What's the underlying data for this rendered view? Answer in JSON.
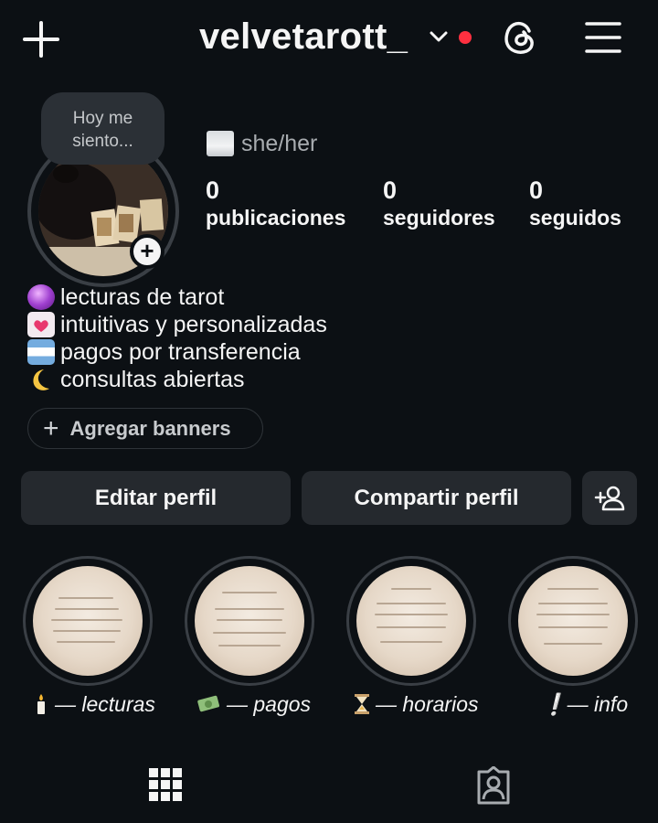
{
  "header": {
    "username": "velvetarott_",
    "has_notification_dot": true,
    "icons": [
      "plus-icon",
      "chevron-down-icon",
      "threads-icon",
      "menu-icon"
    ]
  },
  "profile": {
    "note_bubble": "Hoy me siento...",
    "pronoun": "she/her",
    "stats": [
      {
        "value": "0",
        "label": "publicaciones"
      },
      {
        "value": "0",
        "label": "seguidores"
      },
      {
        "value": "0",
        "label": "seguidos"
      }
    ],
    "bio": [
      {
        "emoji": "crystal-ball",
        "text": "lecturas de tarot"
      },
      {
        "emoji": "heart-letter",
        "text": "intuitivas y personalizadas"
      },
      {
        "emoji": "argentina-flag",
        "text": "pagos por transferencia"
      },
      {
        "emoji": "crescent-moon",
        "text": "consultas abiertas"
      }
    ],
    "banner_button": "Agregar banners"
  },
  "actions": {
    "edit": "Editar perfil",
    "share": "Compartir perfil",
    "add_person_icon": "add-person-icon"
  },
  "highlights": [
    {
      "emoji": "candle",
      "label": "— lecturas"
    },
    {
      "emoji": "money",
      "label": "— pagos"
    },
    {
      "emoji": "hourglass",
      "label": "— horarios"
    },
    {
      "emoji": "exclamation",
      "label": "❕— info"
    }
  ],
  "tabs": [
    "grid-icon",
    "tagged-icon"
  ],
  "colors": {
    "background": "#0c1014",
    "button": "#25292e",
    "notification": "#ff3040"
  }
}
